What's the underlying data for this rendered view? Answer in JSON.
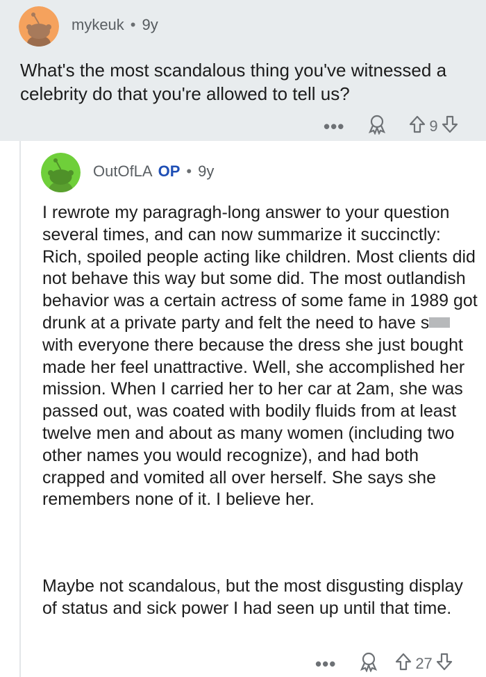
{
  "post": {
    "username": "mykeuk",
    "separator": "•",
    "age": "9y",
    "text": "What's the most scandalous thing you've witnessed a celebrity do that you're allowed to tell us?",
    "more_label": "•••",
    "vote_count": "9",
    "avatar_color": "#f5a25d"
  },
  "reply": {
    "username": "OutOfLA",
    "op_badge": "OP",
    "separator": "•",
    "age": "9y",
    "avatar_color": "#6fcf3a",
    "paragraph1_before_censor": "I rewrote my paragragh-long answer to your question several times, and can now summarize it succinctly: Rich, spoiled people acting like children. Most clients did not behave this way but some did. The most outlandish behavior was a certain actress of some fame in 1989 got drunk at a private party and felt the need to have s",
    "paragraph1_after_censor": "with everyone there because the dress she just bought made her feel unattractive. Well, she accomplished her mission. When I carried her to her car at 2am, she was passed out, was coated with bodily fluids from at least twelve men and about as many women (including two other names you would recognize), and had both crapped and vomited all over herself. She says she remembers none of it. I believe her.",
    "paragraph2": "Maybe not scandalous, but the most disgusting display of status and sick power I had seen up until that time.",
    "more_label": "•••",
    "vote_count": "27"
  },
  "colors": {
    "header_bg": "#e8ecee",
    "op_blue": "#1f4fb5",
    "muted": "#6d7175"
  }
}
